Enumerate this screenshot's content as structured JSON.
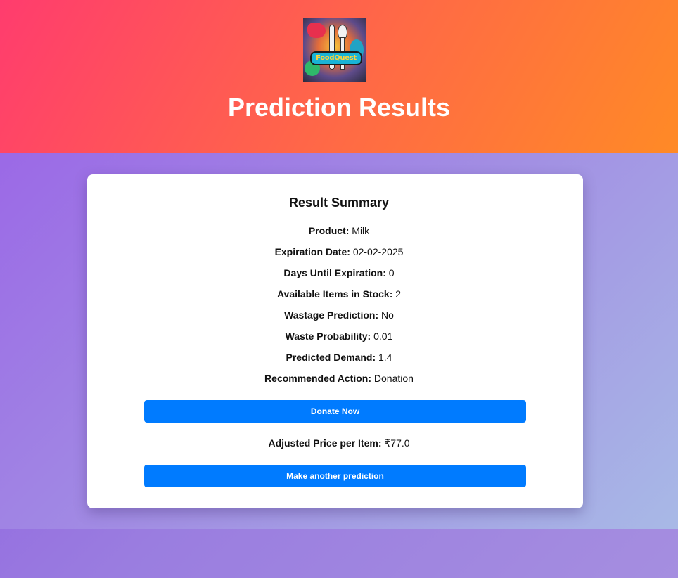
{
  "header": {
    "logo_text": "FoodQuest",
    "title": "Prediction Results"
  },
  "summary": {
    "title": "Result Summary",
    "rows": [
      {
        "label": "Product:",
        "value": "Milk"
      },
      {
        "label": "Expiration Date:",
        "value": "02-02-2025"
      },
      {
        "label": "Days Until Expiration:",
        "value": "0"
      },
      {
        "label": "Available Items in Stock:",
        "value": "2"
      },
      {
        "label": "Wastage Prediction:",
        "value": "No"
      },
      {
        "label": "Waste Probability:",
        "value": "0.01"
      },
      {
        "label": "Predicted Demand:",
        "value": "1.4"
      },
      {
        "label": "Recommended Action:",
        "value": "Donation"
      }
    ],
    "donate_button": "Donate Now",
    "price": {
      "label": "Adjusted Price per Item:",
      "value": "₹77.0"
    },
    "another_button": "Make another prediction"
  },
  "colors": {
    "header_gradient_start": "#ff3c6e",
    "header_gradient_end": "#ff8a26",
    "button_blue": "#007bff",
    "band_gradient_start": "#9b69e6",
    "band_gradient_end": "#a8b9e6"
  },
  "icons": {
    "logo": "foodquest-logo-icon"
  }
}
